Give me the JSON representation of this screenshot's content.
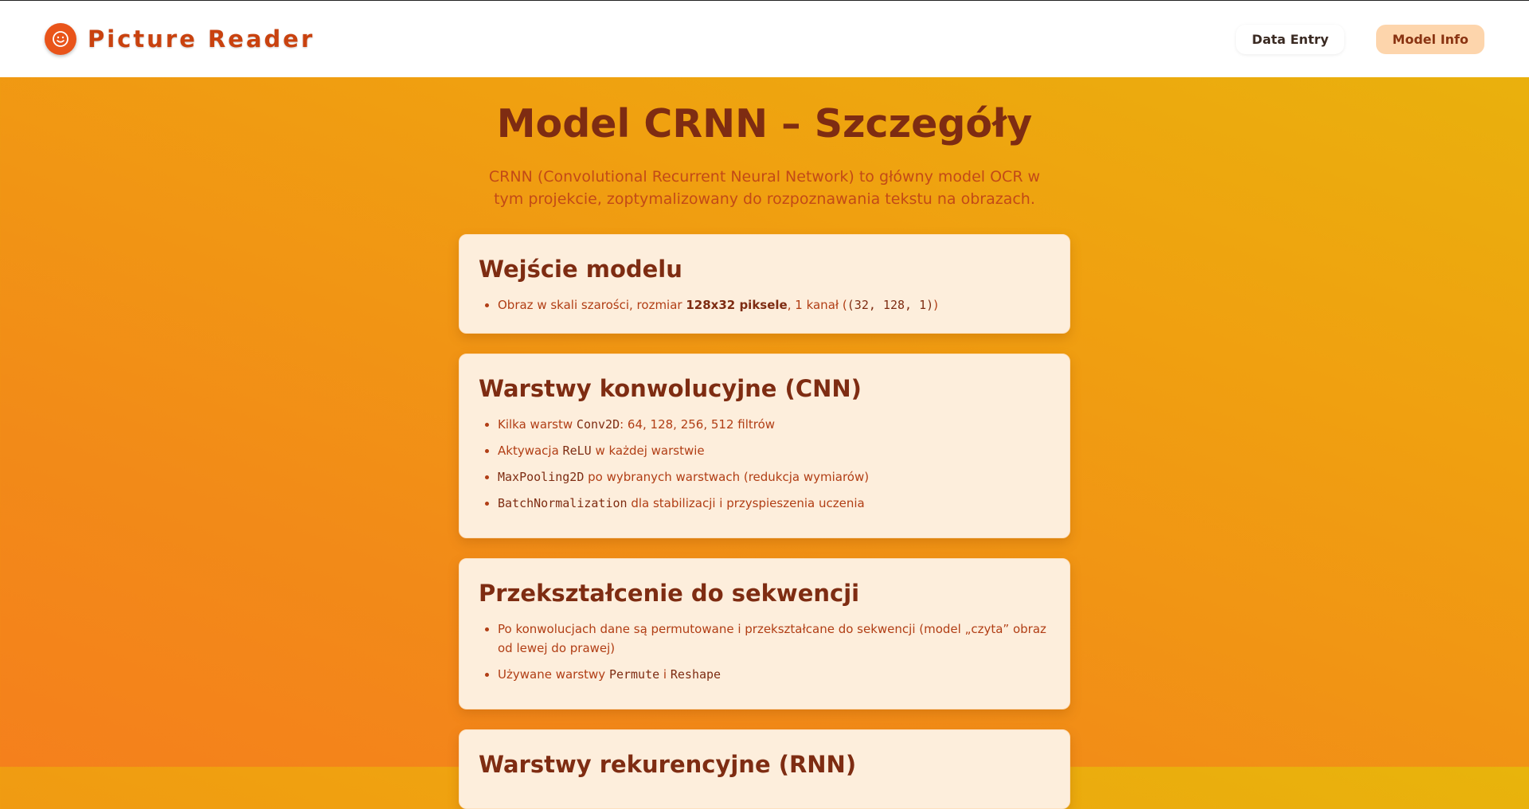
{
  "header": {
    "brand_name": "Picture Reader",
    "brand_icon": "smile-icon",
    "nav": [
      {
        "label": "Data Entry",
        "active": false
      },
      {
        "label": "Model Info",
        "active": true
      }
    ]
  },
  "page": {
    "title": "Model CRNN – Szczegóły",
    "description": "CRNN (Convolutional Recurrent Neural Network) to główny model OCR w tym projekcie, zoptymalizowany do rozpoznawania tekstu na obrazach."
  },
  "sections": [
    {
      "title": "Wejście modelu",
      "items": [
        {
          "parts": [
            {
              "t": "text",
              "v": "Obraz w skali szarości, rozmiar "
            },
            {
              "t": "bold",
              "v": "128x32 piksele"
            },
            {
              "t": "text",
              "v": ", 1 kanał ("
            },
            {
              "t": "code",
              "v": "(32, 128, 1)"
            },
            {
              "t": "text",
              "v": ")"
            }
          ]
        }
      ]
    },
    {
      "title": "Warstwy konwolucyjne (CNN)",
      "items": [
        {
          "parts": [
            {
              "t": "text",
              "v": "Kilka warstw "
            },
            {
              "t": "code",
              "v": "Conv2D"
            },
            {
              "t": "text",
              "v": ": 64, 128, 256, 512 filtrów"
            }
          ]
        },
        {
          "parts": [
            {
              "t": "text",
              "v": "Aktywacja "
            },
            {
              "t": "code",
              "v": "ReLU"
            },
            {
              "t": "text",
              "v": " w każdej warstwie"
            }
          ]
        },
        {
          "parts": [
            {
              "t": "code",
              "v": "MaxPooling2D"
            },
            {
              "t": "text",
              "v": " po wybranych warstwach (redukcja wymiarów)"
            }
          ]
        },
        {
          "parts": [
            {
              "t": "code",
              "v": "BatchNormalization"
            },
            {
              "t": "text",
              "v": " dla stabilizacji i przyspieszenia uczenia"
            }
          ]
        }
      ]
    },
    {
      "title": "Przekształcenie do sekwencji",
      "items": [
        {
          "parts": [
            {
              "t": "text",
              "v": "Po konwolucjach dane są permutowane i przekształcane do sekwencji (model „czyta” obraz od lewej do prawej)"
            }
          ]
        },
        {
          "parts": [
            {
              "t": "text",
              "v": "Używane warstwy "
            },
            {
              "t": "code",
              "v": "Permute"
            },
            {
              "t": "text",
              "v": " i "
            },
            {
              "t": "code",
              "v": "Reshape"
            }
          ]
        }
      ]
    },
    {
      "title": "Warstwy rekurencyjne (RNN)",
      "items": []
    }
  ]
}
